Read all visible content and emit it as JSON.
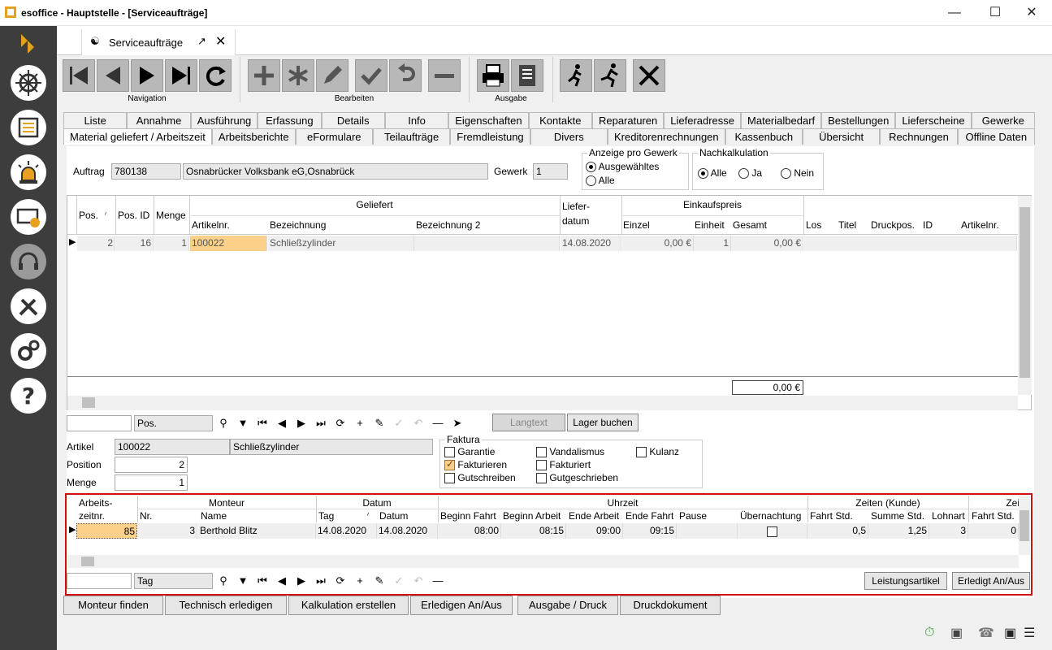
{
  "window": {
    "title": "esoffice - Hauptstelle - [Serviceaufträge]"
  },
  "doc_tab": {
    "label": "Serviceaufträge"
  },
  "toolbar": {
    "groups": [
      "Navigation",
      "Bearbeiten",
      "Ausgabe"
    ]
  },
  "tabs_row1": [
    "Liste",
    "Annahme",
    "Ausführung",
    "Erfassung",
    "Details",
    "Info",
    "Eigenschaften",
    "Kontakte",
    "Reparaturen",
    "Lieferadresse",
    "Materialbedarf",
    "Bestellungen",
    "Lieferscheine",
    "Gewerke"
  ],
  "tabs_row2": [
    "Material geliefert / Arbeitszeit",
    "Arbeitsberichte",
    "eFormulare",
    "Teilaufträge",
    "Fremdleistung",
    "Divers",
    "Kreditorenrechnungen",
    "Kassenbuch",
    "Übersicht",
    "Rechnungen",
    "Offline Daten"
  ],
  "auftrag": {
    "label": "Auftrag",
    "nr": "780138",
    "name": "Osnabrücker Volksbank eG,Osnabrück",
    "gewerk_label": "Gewerk",
    "gewerk": "1"
  },
  "anzeige": {
    "title": "Anzeige pro Gewerk",
    "opt1": "Ausgewähltes",
    "opt2": "Alle"
  },
  "nachkalk": {
    "title": "Nachkalkulation",
    "opt1": "Alle",
    "opt2": "Ja",
    "opt3": "Nein"
  },
  "mat_grid": {
    "h": {
      "pos": "Pos.",
      "posid": "Pos. ID",
      "menge": "Menge",
      "geliefert": "Geliefert",
      "artikelnr": "Artikelnr.",
      "bez": "Bezeichnung",
      "bez2": "Bezeichnung 2",
      "liefer1": "Liefer-",
      "liefer2": "datum",
      "ek": "Einkaufspreis",
      "einzel": "Einzel",
      "einheit": "Einheit",
      "gesamt": "Gesamt",
      "los": "Los",
      "titel": "Titel",
      "druckpos": "Druckpos.",
      "id": "ID",
      "artikelnr2": "Artikelnr."
    },
    "row": {
      "pos": "2",
      "posid": "16",
      "menge": "1",
      "artikelnr": "100022",
      "bez": "Schließzylinder",
      "liefer": "14.08.2020",
      "einzel": "0,00 €",
      "einheit": "1",
      "gesamt": "0,00 €"
    },
    "total": "0,00 €"
  },
  "nav1": {
    "search_field": "Pos."
  },
  "buttons": {
    "langtext": "Langtext",
    "lager": "Lager buchen",
    "leistung": "Leistungsartikel",
    "erledigt": "Erledigt An/Aus"
  },
  "artikel": {
    "label": "Artikel",
    "nr": "100022",
    "name": "Schließzylinder",
    "pos_label": "Position",
    "pos": "2",
    "menge_label": "Menge",
    "menge": "1"
  },
  "faktura": {
    "title": "Faktura",
    "garantie": "Garantie",
    "vandalismus": "Vandalismus",
    "kulanz": "Kulanz",
    "fakturieren": "Fakturieren",
    "fakturiert": "Fakturiert",
    "gutschreiben": "Gutschreiben",
    "gutgeschrieben": "Gutgeschrieben"
  },
  "az_grid": {
    "h": {
      "az1": "Arbeits-",
      "az2": "zeitnr.",
      "monteur": "Monteur",
      "nr": "Nr.",
      "name": "Name",
      "datum": "Datum",
      "tag": "Tag",
      "datum2": "Datum",
      "uhrzeit": "Uhrzeit",
      "bf": "Beginn Fahrt",
      "ba": "Beginn Arbeit",
      "ea": "Ende Arbeit",
      "ef": "Ende Fahrt",
      "pause": "Pause",
      "ueb": "Übernachtung",
      "zk": "Zeiten (Kunde)",
      "fs": "Fahrt Std.",
      "ss": "Summe Std.",
      "lohn": "Lohnart",
      "fs2": "Fahrt Std.",
      "zei": "Zei"
    },
    "row": {
      "az": "85",
      "nr": "3",
      "name": "Berthold Blitz",
      "tag": "14.08.2020",
      "datum": "14.08.2020",
      "bf": "08:00",
      "ba": "08:15",
      "ea": "09:00",
      "ef": "09:15",
      "fs": "0,5",
      "ss": "1,25",
      "lohn": "3",
      "fs2": "0"
    }
  },
  "nav2": {
    "search_field": "Tag"
  },
  "bottom_buttons": [
    "Monteur finden",
    "Technisch erledigen",
    "Kalkulation erstellen",
    "Erledigen An/Aus",
    "Ausgabe / Druck",
    "Druckdokument"
  ]
}
